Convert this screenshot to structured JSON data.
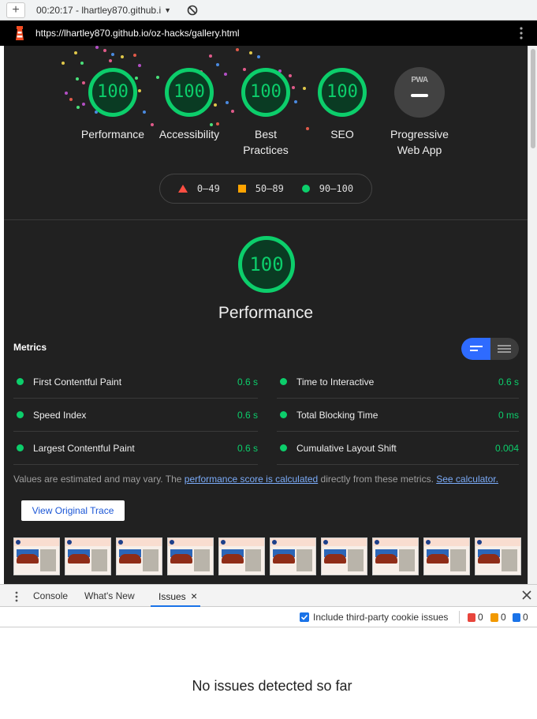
{
  "browser": {
    "new_tab_label": "+",
    "tab_title": "00:20:17 - lhartley870.github.i",
    "url": "https://lhartley870.github.io/oz-hacks/gallery.html"
  },
  "report": {
    "categories": [
      {
        "label": "Performance",
        "score": "100"
      },
      {
        "label": "Accessibility",
        "score": "100"
      },
      {
        "label": "Best Practices",
        "score": "100"
      },
      {
        "label": "SEO",
        "score": "100"
      }
    ],
    "pwa": {
      "badge": "PWA",
      "label": "Progressive Web App"
    },
    "legend": {
      "low": "0–49",
      "mid": "50–89",
      "high": "90–100"
    },
    "colors": {
      "pass": "#0cce6b",
      "average": "#ffa400",
      "fail": "#ff4e42",
      "bg": "#212121"
    },
    "performance": {
      "score": "100",
      "title": "Performance",
      "metrics_title": "Metrics",
      "metrics": [
        {
          "name": "First Contentful Paint",
          "value": "0.6 s"
        },
        {
          "name": "Time to Interactive",
          "value": "0.6 s"
        },
        {
          "name": "Speed Index",
          "value": "0.6 s"
        },
        {
          "name": "Total Blocking Time",
          "value": "0 ms"
        },
        {
          "name": "Largest Contentful Paint",
          "value": "0.6 s"
        },
        {
          "name": "Cumulative Layout Shift",
          "value": "0.004"
        }
      ],
      "note_prefix": "Values are estimated and may vary. The ",
      "note_link1": "performance score is calculated",
      "note_middle": " directly from these metrics. ",
      "note_link2": "See calculator.",
      "trace_button": "View Original Trace"
    }
  },
  "devtools": {
    "tabs": [
      "Console",
      "What's New",
      "Issues"
    ],
    "active_tab": "Issues",
    "tab_close": "×",
    "include_third_party": "Include third-party cookie issues",
    "counts": {
      "errors": "0",
      "warnings": "0",
      "info": "0"
    },
    "empty_message": "No issues detected so far"
  }
}
